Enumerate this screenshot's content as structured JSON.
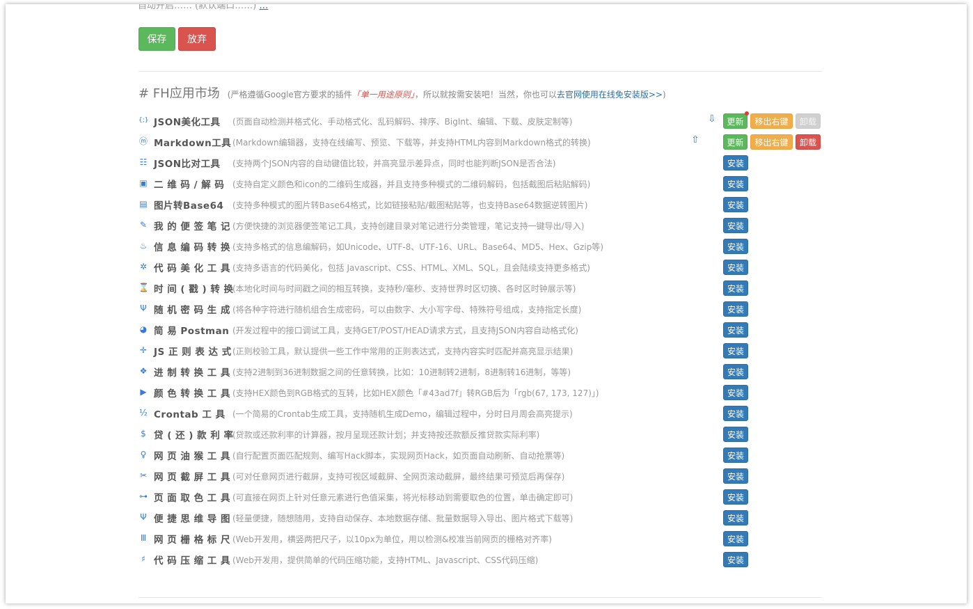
{
  "header_cut": {
    "text": "自动开启…… (默认端口……)",
    "link": "…"
  },
  "buttons": {
    "save": "保存",
    "discard": "放弃"
  },
  "section": {
    "title": "# FH应用市场",
    "note_prefix": "(严格遵循Google官方要求的插件",
    "rule": "「单一用途原则」",
    "note_middle": "，所以就按需安装吧！当然，你也可以",
    "link": "去官网使用在线免安装版>>",
    "note_suffix": ")"
  },
  "actions": {
    "update": "更新",
    "move_out": "移出右键",
    "uninstall": "卸载",
    "install": "安装"
  },
  "tools": [
    {
      "icon": "json-format-icon",
      "glyph": "{;}",
      "name": "JSON美化工具",
      "desc": "(页面自动检测并格式化、手动格式化、乱码解码、排序、BigInt、编辑、下载、皮肤定制等)",
      "installed": true,
      "uninstall_disabled": true,
      "arrow": "⇩",
      "badge": true
    },
    {
      "icon": "markdown-icon",
      "glyph": "ⓜ",
      "name": "Markdown工具",
      "desc": "(Markdown编辑器，支持在线编写、预览、下载等，并支持HTML内容到Markdown格式的转换)",
      "installed": true,
      "uninstall_disabled": false,
      "arrow": "⇧",
      "badge": false
    },
    {
      "icon": "json-diff-icon",
      "glyph": "☷",
      "name": "JSON比对工具",
      "desc": "(支持两个JSON内容的自动键值比较，并高亮显示差异点，同时也能判断JSON是否合法)"
    },
    {
      "icon": "qrcode-icon",
      "glyph": "▣",
      "name": "二 维 码 / 解 码",
      "desc": "(支持自定义颜色和icon的二维码生成器，并且支持多种模式的二维码解码，包括截图后粘贴解码)"
    },
    {
      "icon": "image-base64-icon",
      "glyph": "▤",
      "name": "图片转Base64",
      "desc": "(支持多种模式的图片转Base64格式，比如链接粘贴/截图粘贴等，也支持Base64数据逆转图片)"
    },
    {
      "icon": "sticky-notes-icon",
      "glyph": "✎",
      "name": "我 的 便 签 笔 记",
      "desc": "(方便快捷的浏览器便签笔记工具，支持创建目录对笔记进行分类管理，笔记支持一键导出/导入)"
    },
    {
      "icon": "encode-icon",
      "glyph": "♨",
      "name": "信 息 编 码 转 换",
      "desc": "(支持多格式的信息编解码，如Unicode、UTF-8、UTF-16、URL、Base64、MD5、Hex、Gzip等)"
    },
    {
      "icon": "code-beautify-icon",
      "glyph": "✲",
      "name": "代 码 美 化 工 具",
      "desc": "(支持多语言的代码美化，包括 Javascript、CSS、HTML、XML、SQL，且会陆续支持更多格式)"
    },
    {
      "icon": "timestamp-icon",
      "glyph": "⌛",
      "name": "时 间 ( 戳 ) 转 换",
      "desc": "(本地化时间与时间戳之间的相互转换，支持秒/毫秒、支持世界时区切换、各时区时钟展示等)"
    },
    {
      "icon": "password-icon",
      "glyph": "Ψ",
      "name": "随 机 密 码 生 成",
      "desc": "(将各种字符进行随机组合生成密码，可以由数字、大小写字母、特殊符号组成，支持指定长度)"
    },
    {
      "icon": "postman-icon",
      "glyph": "◕",
      "name": "简 易 Postman",
      "desc": "(开发过程中的接口调试工具，支持GET/POST/HEAD请求方式，且支持JSON内容自动格式化)"
    },
    {
      "icon": "regexp-icon",
      "glyph": "✛",
      "name": "JS 正 则 表 达 式",
      "desc": "(正则校验工具，默认提供一些工作中常用的正则表达式，支持内容实时匹配并高亮显示结果)"
    },
    {
      "icon": "radix-icon",
      "glyph": "❖",
      "name": "进 制 转 换 工 具",
      "desc": "(支持2进制到36进制数据之间的任意转换，比如：10进制转2进制，8进制转16进制，等等)"
    },
    {
      "icon": "color-icon",
      "glyph": "▶",
      "name": "颜 色 转 换 工 具",
      "desc": "(支持HEX颜色到RGB格式的互转，比如HEX颜色「#43ad7f」转RGB后为「rgb(67, 173, 127)」)"
    },
    {
      "icon": "crontab-icon",
      "glyph": "½",
      "name": "Crontab  工  具",
      "desc": "(一个简易的Crontab生成工具，支持随机生成Demo，编辑过程中，分时日月周会高亮提示)"
    },
    {
      "icon": "loan-icon",
      "glyph": "$",
      "name": "贷 ( 还 ) 款 利 率",
      "desc": "(贷款或还款利率的计算器，按月呈现还款计划；并支持按还款额反推贷款实际利率)"
    },
    {
      "icon": "monkey-icon",
      "glyph": "♀",
      "name": "网 页 油 猴 工 具",
      "desc": "(自行配置页面匹配规则、编写Hack脚本，实现网页Hack，如页面自动刷新、自动抢票等)"
    },
    {
      "icon": "screenshot-icon",
      "glyph": "✂",
      "name": "网 页 截 屏 工 具",
      "desc": "(可对任意网页进行截屏，支持可视区域截屏、全网页滚动截屏，最终结果可预览后再保存)"
    },
    {
      "icon": "color-picker-icon",
      "glyph": "⊶",
      "name": "页 面 取 色 工 具",
      "desc": "(可直接在网页上针对任意元素进行色值采集，将光标移动到需要取色的位置，单击确定即可)"
    },
    {
      "icon": "mindmap-icon",
      "glyph": "Ψ",
      "name": "便 捷 思 维 导 图",
      "desc": "(轻量便捷，随想随用，支持自动保存、本地数据存储、批量数据导入导出、图片格式下载等)"
    },
    {
      "icon": "grid-ruler-icon",
      "glyph": "Ⅲ",
      "name": "网 页 栅 格 标 尺",
      "desc": "(Web开发用，横竖两把尺子，以10px为单位，用以检测&校准当前网页的栅格对齐率)"
    },
    {
      "icon": "code-compress-icon",
      "glyph": "♯",
      "name": "代 码 压 缩 工 具",
      "desc": "(Web开发用，提供简单的代码压缩功能，支持HTML、Javascript、CSS代码压缩)"
    }
  ]
}
